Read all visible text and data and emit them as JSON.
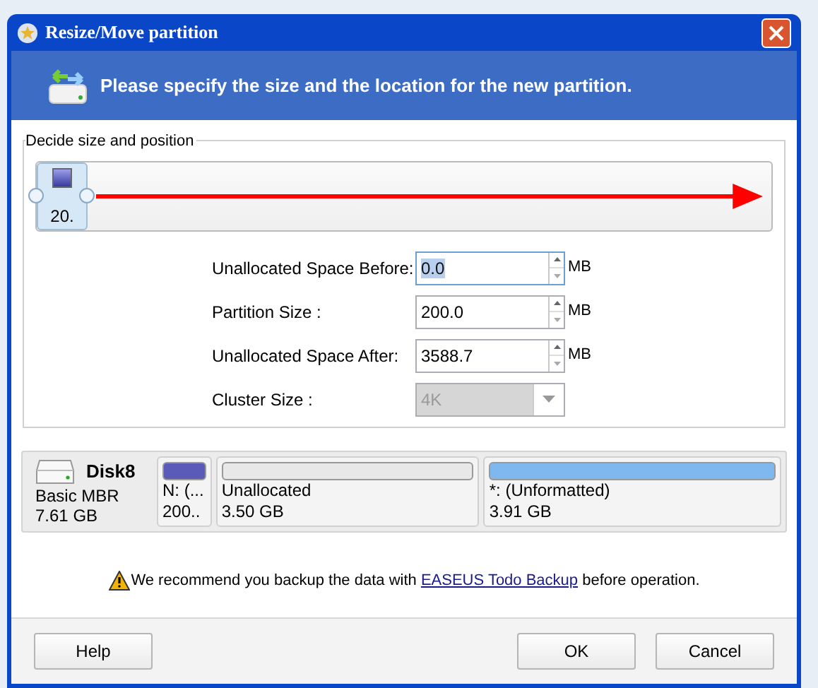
{
  "window": {
    "title": "Resize/Move partition"
  },
  "header": {
    "message": "Please specify the size and the location for the new partition."
  },
  "group": {
    "label": "Decide size and position"
  },
  "slider": {
    "handle_label": "20."
  },
  "fields": [
    {
      "label": "Unallocated Space Before:",
      "value": "0.0",
      "unit": "MB",
      "kind": "spin",
      "selected": true,
      "disabled": false
    },
    {
      "label": "Partition Size :",
      "value": "200.0",
      "unit": "MB",
      "kind": "spin",
      "selected": false,
      "disabled": false
    },
    {
      "label": "Unallocated Space After:",
      "value": "3588.7",
      "unit": "MB",
      "kind": "spin",
      "selected": false,
      "disabled": false
    },
    {
      "label": "Cluster Size :",
      "value": "4K",
      "kind": "dropdown",
      "disabled": true
    }
  ],
  "disk": {
    "name": "Disk8",
    "type": "Basic MBR",
    "size": "7.61 GB",
    "partitions": [
      {
        "label": "N: (...",
        "size": "200..",
        "color": "#5a5ab8"
      },
      {
        "label": "Unallocated",
        "size": "3.50 GB",
        "color": "#e8e8e8"
      },
      {
        "label": "*: (Unformatted)",
        "size": "3.91 GB",
        "color": "#7fb8ef"
      }
    ]
  },
  "notice": {
    "before": "We recommend you backup the data with ",
    "link": "EASEUS Todo Backup",
    "after": " before operation."
  },
  "buttons": [
    "Help",
    "OK",
    "Cancel"
  ]
}
